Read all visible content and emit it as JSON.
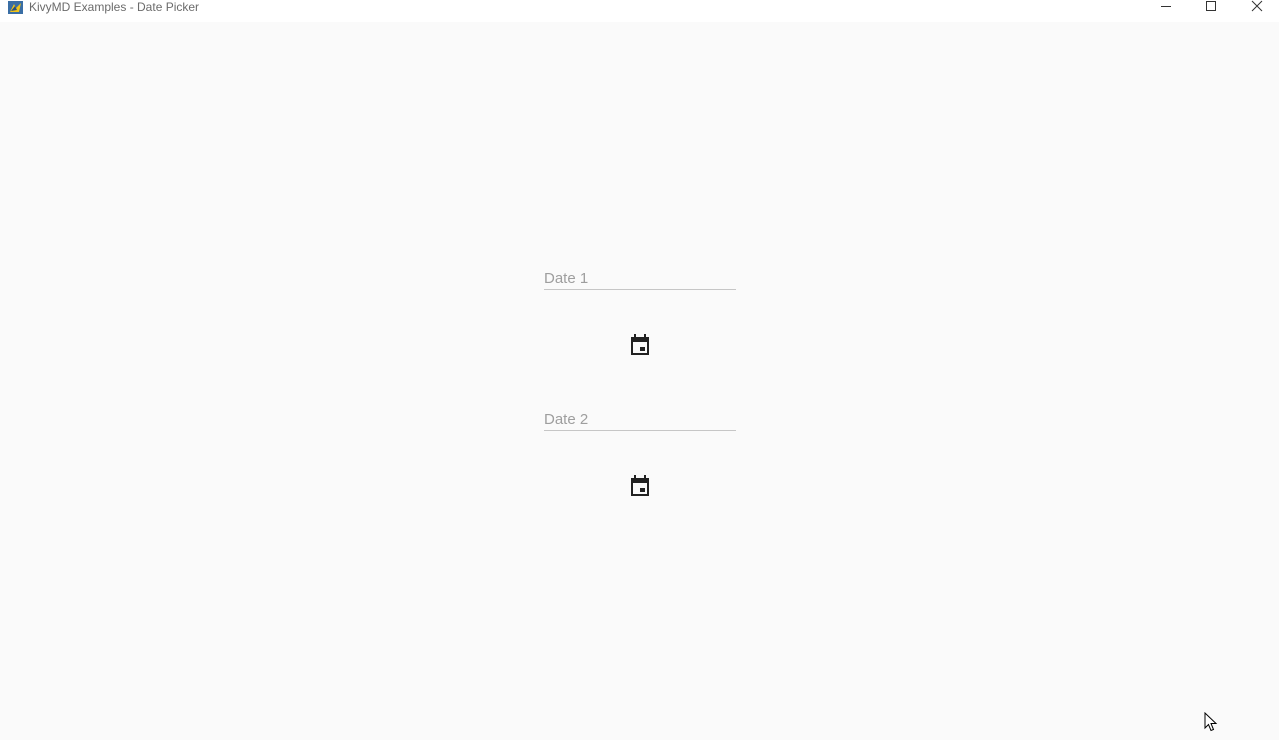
{
  "window": {
    "title": "KivyMD Examples - Date Picker",
    "app_icon": "kivy-app-icon",
    "controls": [
      "minimize-icon",
      "maximize-icon",
      "close-icon"
    ]
  },
  "fields": {
    "date1": {
      "placeholder": "Date 1",
      "value": ""
    },
    "date2": {
      "placeholder": "Date 2",
      "value": ""
    }
  },
  "buttons": {
    "calendar1_icon": "calendar-icon",
    "calendar2_icon": "calendar-icon"
  },
  "colors": {
    "background": "#fafafa",
    "titlebar": "#ffffff",
    "placeholder_text": "#9e9e9e",
    "underline": "#c6c6c6",
    "icon": "#212121"
  }
}
